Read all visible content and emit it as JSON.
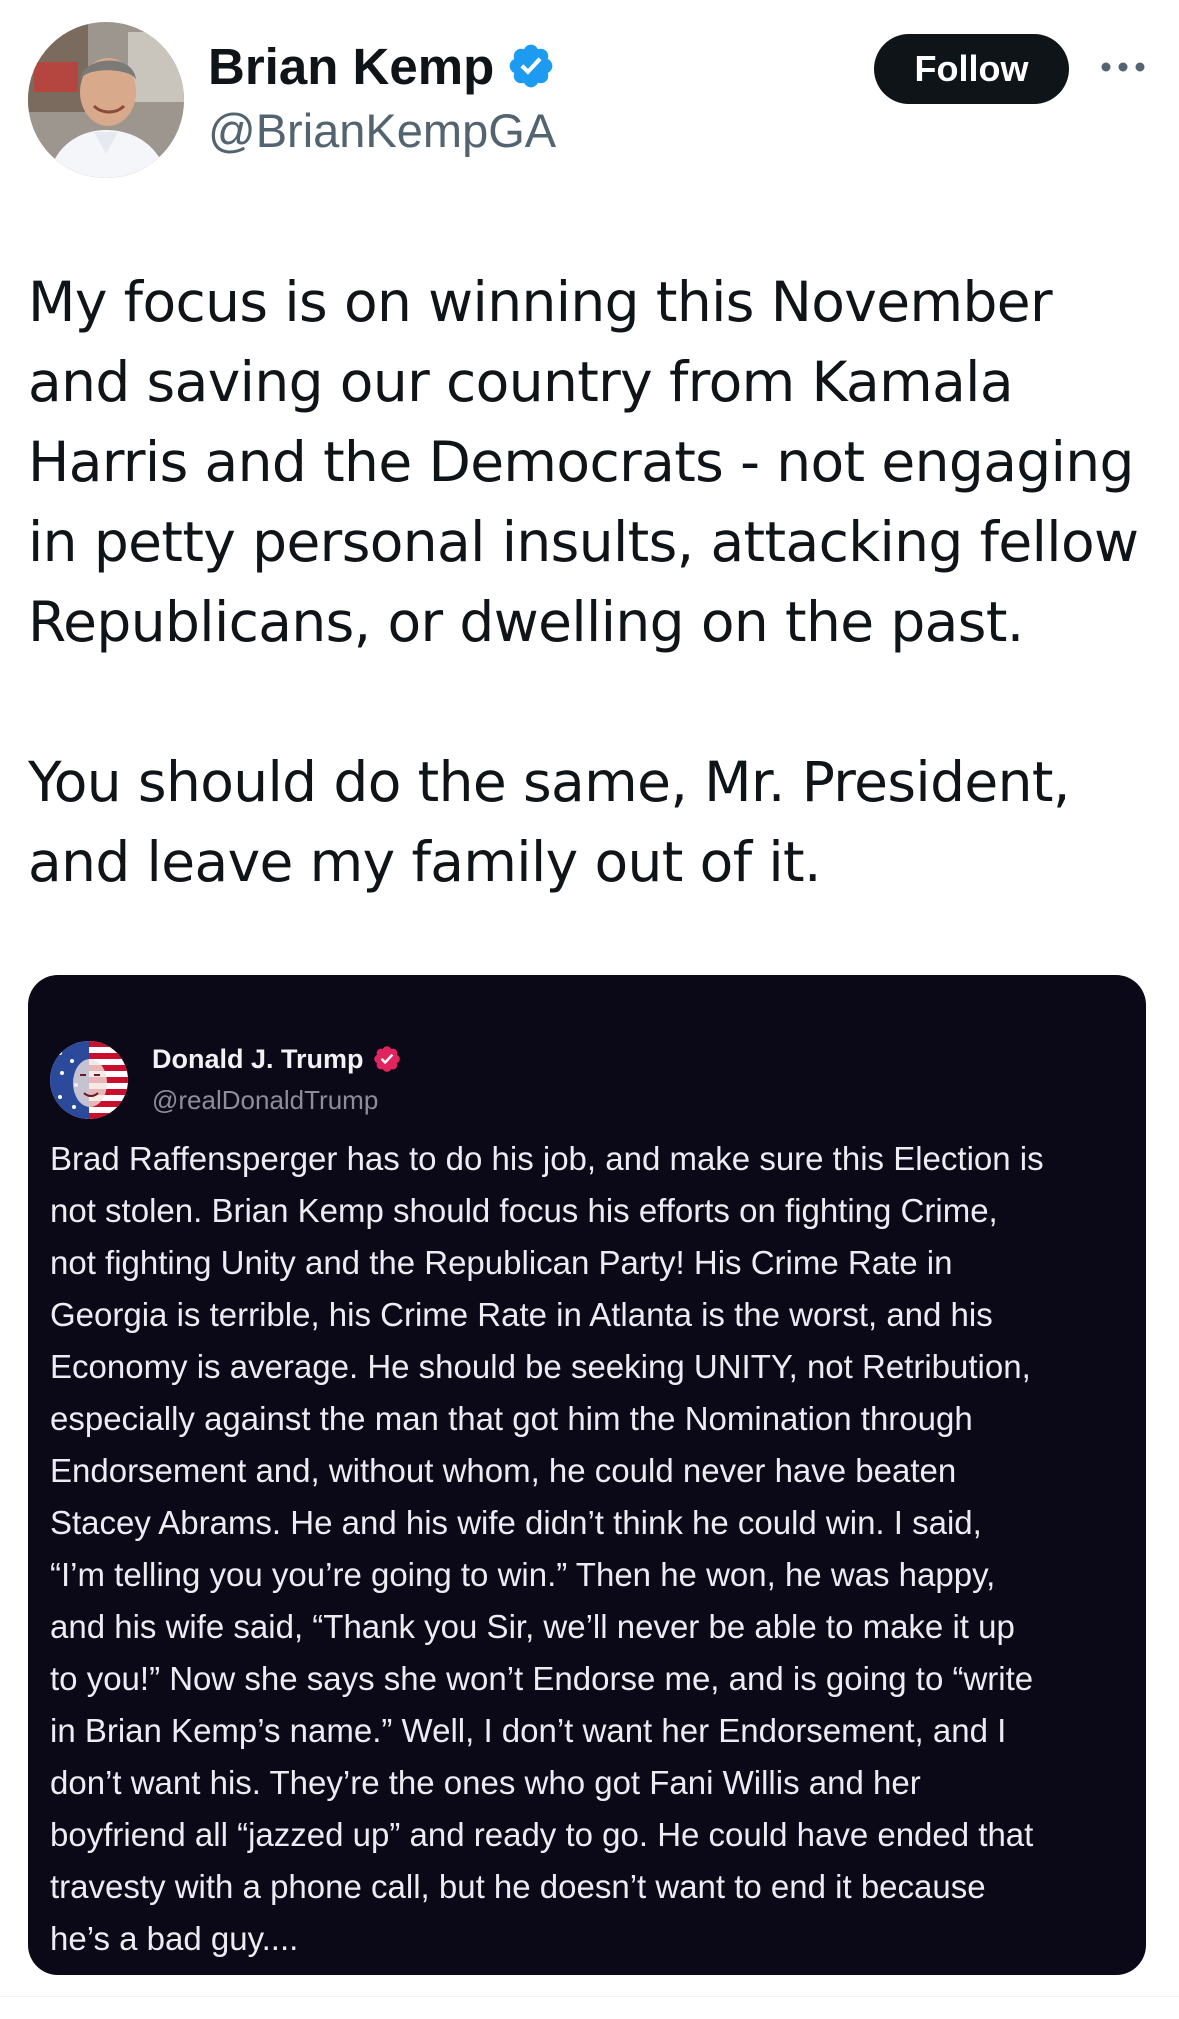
{
  "author": {
    "display_name": "Brian Kemp",
    "handle": "@BrianKempGA",
    "verified": true
  },
  "follow_label": "Follow",
  "tweet": {
    "paragraphs": [
      "My focus is on winning this November\nand saving our country from Kamala\nHarris and the Democrats - not engaging\nin petty personal insults, attacking fellow\nRepublicans, or dwelling on the past.",
      "You should do the same, Mr. President,\nand leave my family out of it."
    ]
  },
  "quoted": {
    "display_name": "Donald J. Trump",
    "handle": "@realDonaldTrump",
    "body_lines": [
      "Brad Raffensperger has to do his job, and make sure this Election is",
      "not stolen. Brian Kemp should focus his efforts on fighting Crime,",
      "not fighting Unity and the Republican Party! His Crime Rate in",
      "Georgia is terrible, his Crime Rate in Atlanta is the worst, and his",
      "Economy is average. He should be seeking UNITY, not Retribution,",
      "especially against the man that got him the Nomination through",
      "Endorsement and, without whom, he could never have beaten",
      "Stacey Abrams. He and his wife didn’t think he could win. I said,",
      "“I’m telling you you’re going to win.” Then he won, he was happy,",
      "and his wife said, “Thank you Sir, we’ll never be able to make it up",
      "to you!” Now she says she won’t Endorse me, and is going to “write",
      "in Brian Kemp’s name.” Well, I don’t want her Endorsement, and I",
      "don’t want his. They’re the ones who got Fani Willis and her",
      "boyfriend all “jazzed up” and ready to go. He could have ended that",
      "travesty with a phone call, but he doesn’t want to end it because",
      "he’s a bad guy...."
    ]
  },
  "icons": {
    "verified": "verified-badge-icon",
    "more": "more-options-icon"
  },
  "colors": {
    "verified_blue": "#1d9bf0",
    "quoted_badge_pink": "#e0245e",
    "card_background": "#0b0918",
    "follow_button": "#0f1419"
  }
}
